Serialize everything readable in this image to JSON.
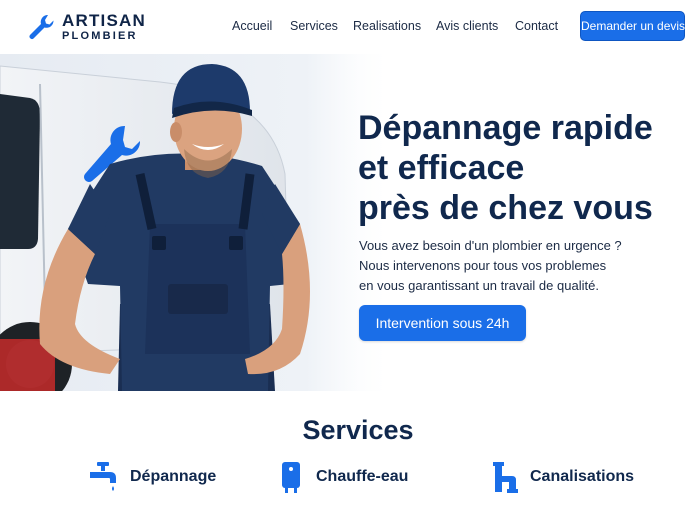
{
  "header": {
    "logo": {
      "line1": "ARTISAN",
      "line2": "PLOMBIER",
      "icon": "wrench-icon"
    },
    "nav": [
      "Accueil",
      "Services",
      "Realisations",
      "Avis clients",
      "Contact"
    ],
    "cta_label": "Demander un devis"
  },
  "hero": {
    "title_lines": [
      "Dépannage rapide",
      "et efficace",
      "près de chez vous"
    ],
    "text_lines": [
      "Vous avez besoin d'un plombier en urgence ?",
      "Nous intervenons pour tous vos problemes",
      "en vous garantissant un travail de qualité."
    ],
    "cta_label": "Intervention sous 24h",
    "image": "plumber-photo"
  },
  "services": {
    "title": "Services",
    "items": [
      {
        "label": "Dépannage",
        "icon": "faucet-icon"
      },
      {
        "label": "Chauffe-eau",
        "icon": "water-heater-icon"
      },
      {
        "label": "Canalisations",
        "icon": "pipe-icon"
      }
    ]
  },
  "colors": {
    "accent": "#1a6ee8",
    "navy": "#10284d",
    "text": "#1b2a44",
    "background": "#ffffff"
  }
}
